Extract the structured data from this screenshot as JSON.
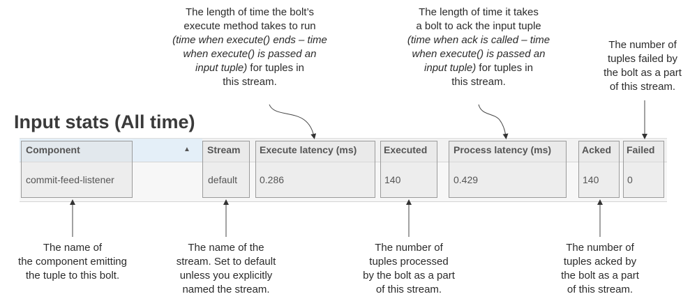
{
  "title": "Input stats (All time)",
  "table": {
    "headers": [
      "Component",
      "Stream",
      "Execute latency (ms)",
      "Executed",
      "Process latency (ms)",
      "Acked",
      "Failed"
    ],
    "row": [
      "commit-feed-listener",
      "default",
      "0.286",
      "140",
      "0.429",
      "140",
      "0"
    ]
  },
  "top_notes": {
    "execute_latency": {
      "l1": "The length of time the bolt’s",
      "l2": "execute method takes to run",
      "l3": "(time when execute() ends – time",
      "l4": "when execute() is passed an",
      "l5a": "input tuple)",
      "l5b": " for tuples in",
      "l6": "this stream."
    },
    "process_latency": {
      "l1": "The length of time it takes",
      "l2": "a bolt to ack the input tuple",
      "l3": "(time when ack is called – time",
      "l4": "when execute() is passed an",
      "l5a": "input tuple)",
      "l5b": " for tuples in",
      "l6": "this stream."
    },
    "failed": {
      "l1": "The number of",
      "l2": "tuples failed by",
      "l3": "the bolt as a part",
      "l4": "of this stream."
    }
  },
  "bottom_notes": {
    "component": {
      "l1": "The name of",
      "l2": "the component emitting",
      "l3": "the tuple to this bolt."
    },
    "stream": {
      "l1": "The name of the",
      "l2": "stream. Set to default",
      "l3": "unless you explicitly",
      "l4": "named the stream."
    },
    "executed": {
      "l1": "The number of",
      "l2": "tuples processed",
      "l3": "by the bolt as a part",
      "l4": "of this stream."
    },
    "acked": {
      "l1": "The number of",
      "l2": "tuples acked by",
      "l3": "the bolt as a part",
      "l4": "of this stream."
    }
  }
}
